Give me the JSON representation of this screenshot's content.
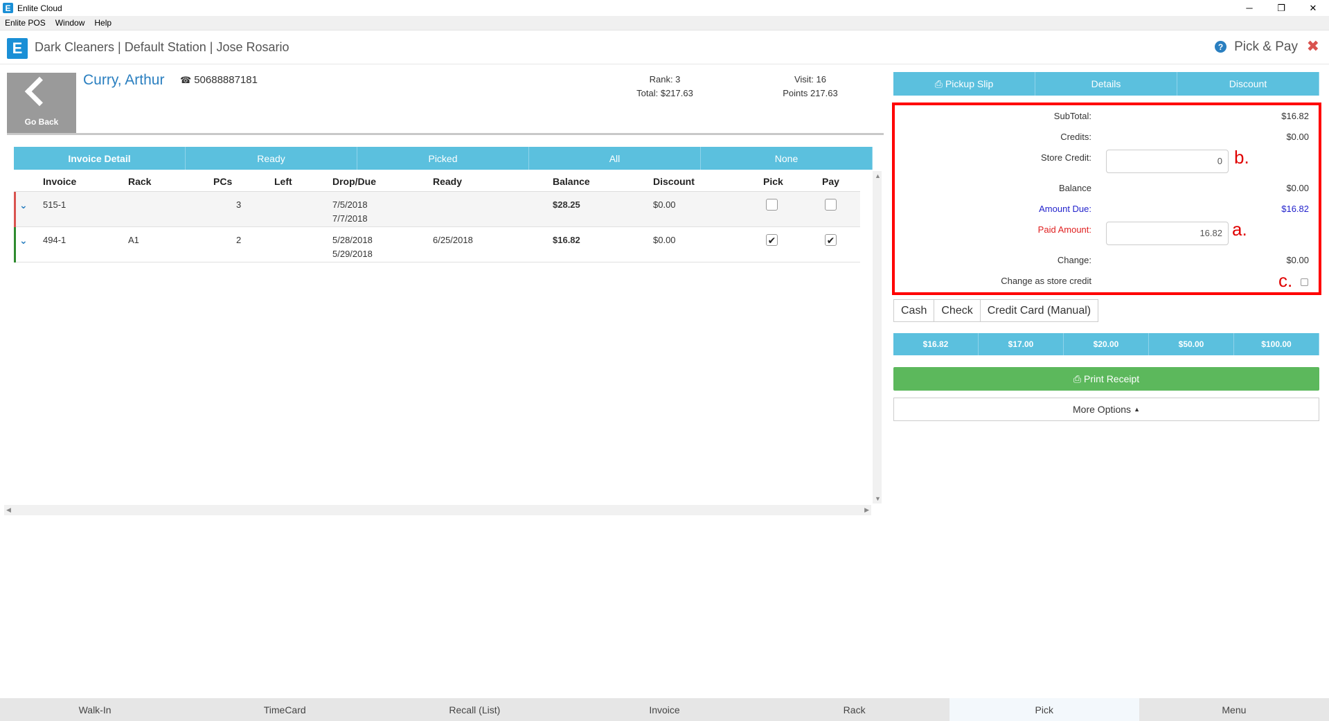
{
  "window": {
    "title": "Enlite Cloud",
    "logo_letter": "E",
    "controls": {
      "minimize": "─",
      "restore": "❐",
      "close": "✕"
    }
  },
  "menubar": [
    "Enlite POS",
    "Window",
    "Help"
  ],
  "header": {
    "breadcrumb": "Dark Cleaners | Default Station | Jose Rosario",
    "page_title": "Pick & Pay",
    "help_glyph": "?",
    "close_glyph": "✖"
  },
  "customer": {
    "go_back": "Go Back",
    "name": "Curry, Arthur",
    "phone": "50688887181",
    "rank": "Rank: 3",
    "total": "Total: $217.63",
    "visit": "Visit: 16",
    "points": "Points 217.63"
  },
  "filter_tabs": [
    "Invoice Detail",
    "Ready",
    "Picked",
    "All",
    "None"
  ],
  "table": {
    "headers": [
      "Invoice",
      "Rack",
      "PCs",
      "Left",
      "Drop/Due",
      "Ready",
      "Balance",
      "Discount",
      "Pick",
      "Pay"
    ],
    "rows": [
      {
        "invoice": "515-1",
        "rack": "",
        "pcs": "3",
        "left": "",
        "drop": "7/5/2018",
        "due": "7/7/2018",
        "ready": "",
        "balance": "$28.25",
        "discount": "$0.00",
        "pick": false,
        "pay": false,
        "status_color": "#d9534f"
      },
      {
        "invoice": "494-1",
        "rack": "A1",
        "pcs": "2",
        "left": "",
        "drop": "5/28/2018",
        "due": "5/29/2018",
        "ready": "6/25/2018",
        "balance": "$16.82",
        "discount": "$0.00",
        "pick": true,
        "pay": true,
        "status_color": "#2e8b2e"
      }
    ]
  },
  "right_tabs": [
    "Pickup Slip",
    "Details",
    "Discount"
  ],
  "summary": {
    "subtotal_label": "SubTotal:",
    "subtotal": "$16.82",
    "credits_label": "Credits:",
    "credits": "$0.00",
    "store_credit_label": "Store Credit:",
    "store_credit": "0",
    "balance_label": "Balance",
    "balance": "$0.00",
    "amount_due_label": "Amount Due:",
    "amount_due": "$16.82",
    "paid_amount_label": "Paid Amount:",
    "paid_amount": "16.82",
    "change_label": "Change:",
    "change": "$0.00",
    "change_store_credit_label": "Change as store credit",
    "mark_a": "a.",
    "mark_b": "b.",
    "mark_c": "c."
  },
  "payment_types": [
    "Cash",
    "Check",
    "Credit Card (Manual)"
  ],
  "quick_amounts": [
    "$16.82",
    "$17.00",
    "$20.00",
    "$50.00",
    "$100.00"
  ],
  "actions": {
    "print_receipt": "Print Receipt",
    "more_options": "More Options"
  },
  "bottom_nav": [
    "Walk-In",
    "TimeCard",
    "Recall (List)",
    "Invoice",
    "Rack",
    "Pick",
    "Menu"
  ],
  "colors": {
    "accent": "#5bc0de",
    "brand": "#1a8fd6",
    "link": "#2a7fc0",
    "print": "#5cb85c",
    "highlight_box": "#ff0000"
  }
}
